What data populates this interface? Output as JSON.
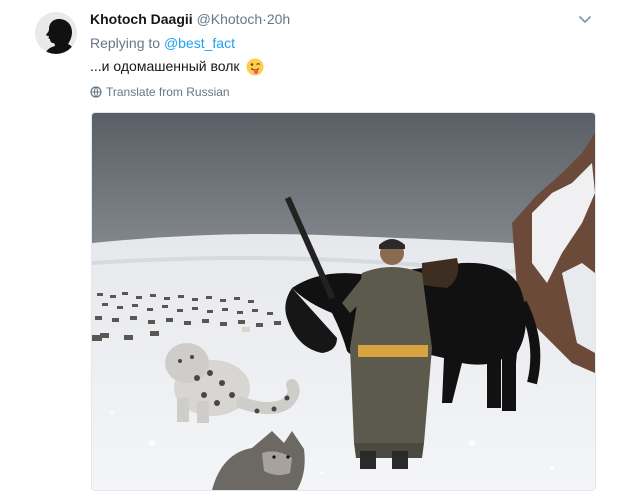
{
  "tweet": {
    "author_name": "Khotoch Daagii",
    "author_handle": "@Khotoch",
    "separator": "·",
    "timestamp": "20h",
    "replying_prefix": "Replying to",
    "replying_handle": "@best_fact",
    "text": "...и одомашенный волк",
    "emoji": "winking-tongue-face",
    "translate_label": "Translate from Russian"
  },
  "icons": {
    "avatar": "silhouette-avatar",
    "menu": "chevron-down-icon",
    "translate": "globe-icon"
  },
  "colors": {
    "link": "#1da1f2",
    "secondary_text": "#657786",
    "primary_text": "#14171a"
  }
}
